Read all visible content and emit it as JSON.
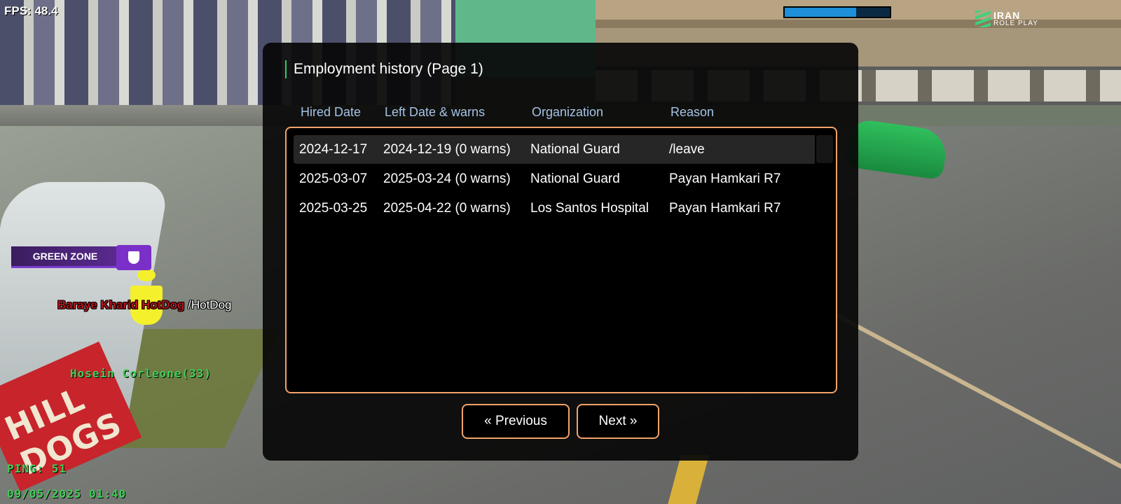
{
  "hud": {
    "fps": "FPS: 48.4",
    "health_fraction": 0.68,
    "logo_main": "IRAN",
    "logo_sub": "ROLE PLAY",
    "zone_label": "GREEN ZONE",
    "npc_label_red": "Baraye Kharid HotDog",
    "npc_label_cmd": "/HotDog",
    "player_name": "Hosein Corleone(33)",
    "ping": "PING: 51",
    "datetime": "09/05/2025 01:40",
    "stand_sign": "HILL DOGS"
  },
  "dialog": {
    "title": "Employment history (Page 1)",
    "columns": [
      "Hired Date",
      "Left Date & warns",
      "Organization",
      "Reason"
    ],
    "rows": [
      {
        "hired": "2024-12-17",
        "left": "2024-12-19 (0 warns)",
        "org": "National Guard",
        "reason": "/leave"
      },
      {
        "hired": "2025-03-07",
        "left": "2025-03-24 (0 warns)",
        "org": "National Guard",
        "reason": "Payan Hamkari R7"
      },
      {
        "hired": "2025-03-25",
        "left": "2025-04-22 (0 warns)",
        "org": "Los Santos Hospital",
        "reason": "Payan Hamkari R7"
      }
    ],
    "prev_label": "« Previous",
    "next_label": "Next »"
  },
  "colors": {
    "accent_border": "#f2a26a",
    "header_text": "#a6c2e6",
    "title_marker": "#2ecc71",
    "hud_green": "#3fcf58"
  }
}
